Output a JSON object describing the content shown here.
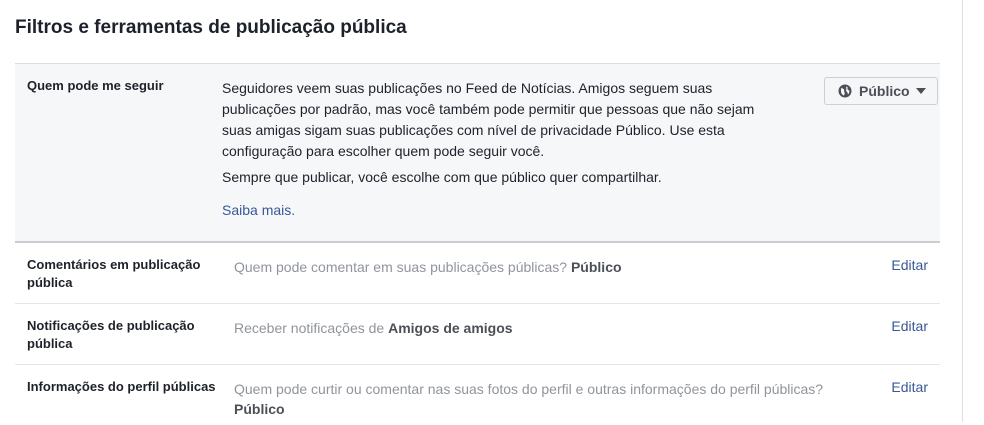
{
  "page": {
    "title": "Filtros e ferramentas de publicação pública"
  },
  "followers": {
    "label": "Quem pode me seguir",
    "description": "Seguidores veem suas publicações no Feed de Notícias. Amigos seguem suas publicações por padrão, mas você também pode permitir que pessoas que não sejam suas amigas sigam suas publicações com nível de privacidade Público. Use esta configuração para escolher quem pode seguir você.",
    "note": "Sempre que publicar, você escolhe com que público quer compartilhar.",
    "learn_more": "Saiba mais.",
    "audience_selected": "Público",
    "audience_icon": "globe-icon"
  },
  "rows": [
    {
      "label": "Comentários em publicação pública",
      "value_prefix": "Quem pode comentar em suas publicações públicas? ",
      "value_bold": "Público",
      "edit": "Editar"
    },
    {
      "label": "Notificações de publicação pública",
      "value_prefix": "Receber notificações de ",
      "value_bold": "Amigos de amigos",
      "edit": "Editar"
    },
    {
      "label": "Informações do perfil públicas",
      "value_prefix": "Quem pode curtir ou comentar nas suas fotos do perfil e outras informações do perfil públicas? ",
      "value_bold": "Público",
      "edit": "Editar"
    }
  ],
  "colors": {
    "link": "#385898",
    "muted_text": "#90949c",
    "expanded_bg": "#f6f7f9"
  }
}
